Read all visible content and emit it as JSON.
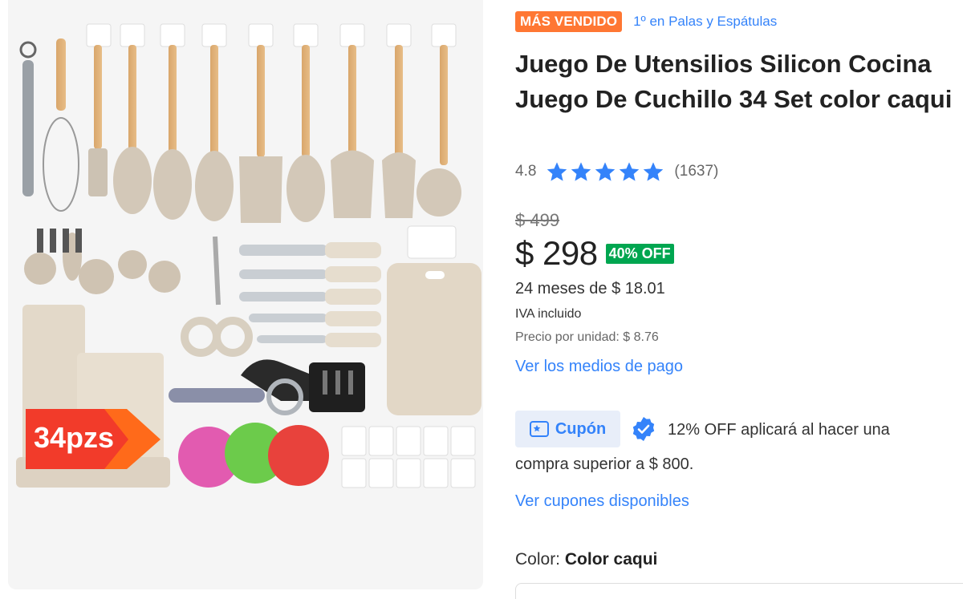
{
  "product_image": {
    "badge_text": "34pzs"
  },
  "badges": {
    "best_seller": "MÁS VENDIDO",
    "ranking": "1º en Palas y Espátulas"
  },
  "title": "Juego De Utensilios Silicon Cocina Juego De Cuchillo 34 Set color caqui",
  "rating": {
    "value": "4.8",
    "stars": 5,
    "count": "(1637)"
  },
  "pricing": {
    "old_price": "$ 499",
    "price": "$ 298",
    "discount": "40% OFF",
    "installments": "24 meses de $ 18.01",
    "tax": "IVA incluido",
    "unit_price": "Precio por unidad: $ 8.76",
    "payment_link": "Ver los medios de pago"
  },
  "coupon": {
    "label": "Cupón",
    "text_line1": "12% OFF aplicará al hacer una",
    "text_line2": "compra superior a $ 800.",
    "link": "Ver cupones disponibles"
  },
  "color": {
    "label": "Color:",
    "value": "Color caqui"
  },
  "colors": {
    "accent_blue": "#3483fa",
    "best_seller_orange": "#ff7733",
    "discount_green": "#00a650",
    "star_blue": "#3483fa"
  },
  "icons": [
    "star-icon",
    "coupon-icon",
    "check-badge-icon"
  ]
}
